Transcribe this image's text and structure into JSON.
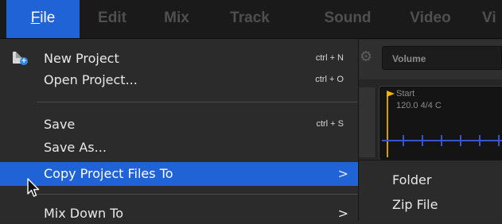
{
  "menubar": {
    "items": [
      {
        "label": "File",
        "mnemonic": "F",
        "rest": "ile",
        "active": true
      },
      {
        "label": "Edit"
      },
      {
        "label": "Mix"
      },
      {
        "label": "Track"
      },
      {
        "label": "Sound"
      },
      {
        "label": "Video"
      },
      {
        "label": "Vi"
      }
    ]
  },
  "background": {
    "volume_label": "Volume",
    "start_label": "Start",
    "tempo_text": "120.0 4/4 C",
    "gear_icon": "gear-icon"
  },
  "file_menu": {
    "items": [
      {
        "label": "New Project",
        "shortcut": "ctrl + N",
        "icon": "new-document-icon"
      },
      {
        "label": "Open Project...",
        "shortcut": "ctrl + O"
      },
      {
        "label": "Save",
        "shortcut": "ctrl + S"
      },
      {
        "label": "Save As..."
      },
      {
        "label": "Copy Project Files To",
        "submenu_arrow": ">",
        "highlighted": true
      },
      {
        "label": "Mix Down To",
        "submenu_arrow": ">"
      }
    ]
  },
  "submenu": {
    "items": [
      {
        "label": "Folder"
      },
      {
        "label": "Zip File"
      }
    ]
  },
  "colors": {
    "accent": "#1f63d7",
    "menubar_bg": "#1a1a1a",
    "menu_bg": "#2b2b2b",
    "menu_text": "#e8e8e8",
    "inactive_menubar_text": "#4f4f4f"
  },
  "cursor": {
    "icon": "mouse-pointer-icon"
  }
}
